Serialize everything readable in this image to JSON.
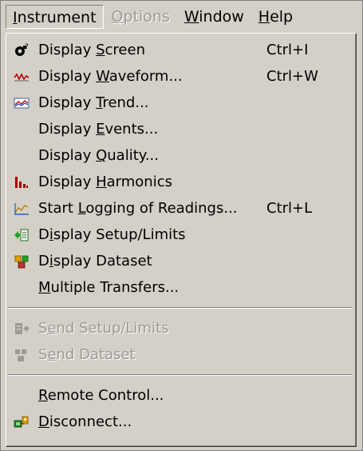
{
  "menubar": {
    "items": [
      {
        "label": "Instrument",
        "mnemonic_index": 0,
        "state": "active"
      },
      {
        "label": "Options",
        "mnemonic_index": 0,
        "state": "disabled"
      },
      {
        "label": "Window",
        "mnemonic_index": 0,
        "state": "normal"
      },
      {
        "label": "Help",
        "mnemonic_index": 0,
        "state": "normal"
      }
    ]
  },
  "menu": {
    "items": [
      {
        "label": "Display Screen",
        "mnemonic_index": 8,
        "shortcut": "Ctrl+I",
        "icon": "camera-screen-icon",
        "enabled": true
      },
      {
        "label": "Display Waveform...",
        "mnemonic_index": 8,
        "shortcut": "Ctrl+W",
        "icon": "waveform-icon",
        "enabled": true
      },
      {
        "label": "Display Trend...",
        "mnemonic_index": 8,
        "shortcut": "",
        "icon": "trend-icon",
        "enabled": true
      },
      {
        "label": "Display Events...",
        "mnemonic_index": 8,
        "shortcut": "",
        "icon": "",
        "enabled": true
      },
      {
        "label": "Display Quality...",
        "mnemonic_index": 8,
        "shortcut": "",
        "icon": "",
        "enabled": true
      },
      {
        "label": "Display Harmonics",
        "mnemonic_index": 8,
        "shortcut": "",
        "icon": "harmonics-bars-icon",
        "enabled": true
      },
      {
        "label": "Start Logging of Readings...",
        "mnemonic_index": 6,
        "shortcut": "Ctrl+L",
        "icon": "logging-chart-icon",
        "enabled": true
      },
      {
        "label": "Display Setup/Limits",
        "mnemonic_index": 1,
        "shortcut": "",
        "icon": "setup-limits-icon",
        "enabled": true
      },
      {
        "label": "Display Dataset",
        "mnemonic_index": 1,
        "shortcut": "",
        "icon": "dataset-icon",
        "enabled": true
      },
      {
        "label": "Multiple Transfers...",
        "mnemonic_index": 0,
        "shortcut": "",
        "icon": "",
        "enabled": true
      },
      {
        "separator": true
      },
      {
        "label": "Send Setup/Limits",
        "mnemonic_index": 1,
        "shortcut": "",
        "icon": "send-setup-icon",
        "enabled": false
      },
      {
        "label": "Send Dataset",
        "mnemonic_index": 1,
        "shortcut": "",
        "icon": "send-dataset-icon",
        "enabled": false
      },
      {
        "separator": true
      },
      {
        "label": "Remote Control...",
        "mnemonic_index": 0,
        "shortcut": "",
        "icon": "",
        "enabled": true
      },
      {
        "label": "Disconnect...",
        "mnemonic_index": 0,
        "shortcut": "",
        "icon": "disconnect-icon",
        "enabled": true
      }
    ]
  },
  "colors": {
    "menu_bg": "#d4d0c8",
    "disabled_text": "#9d9a94",
    "text": "#000000"
  }
}
